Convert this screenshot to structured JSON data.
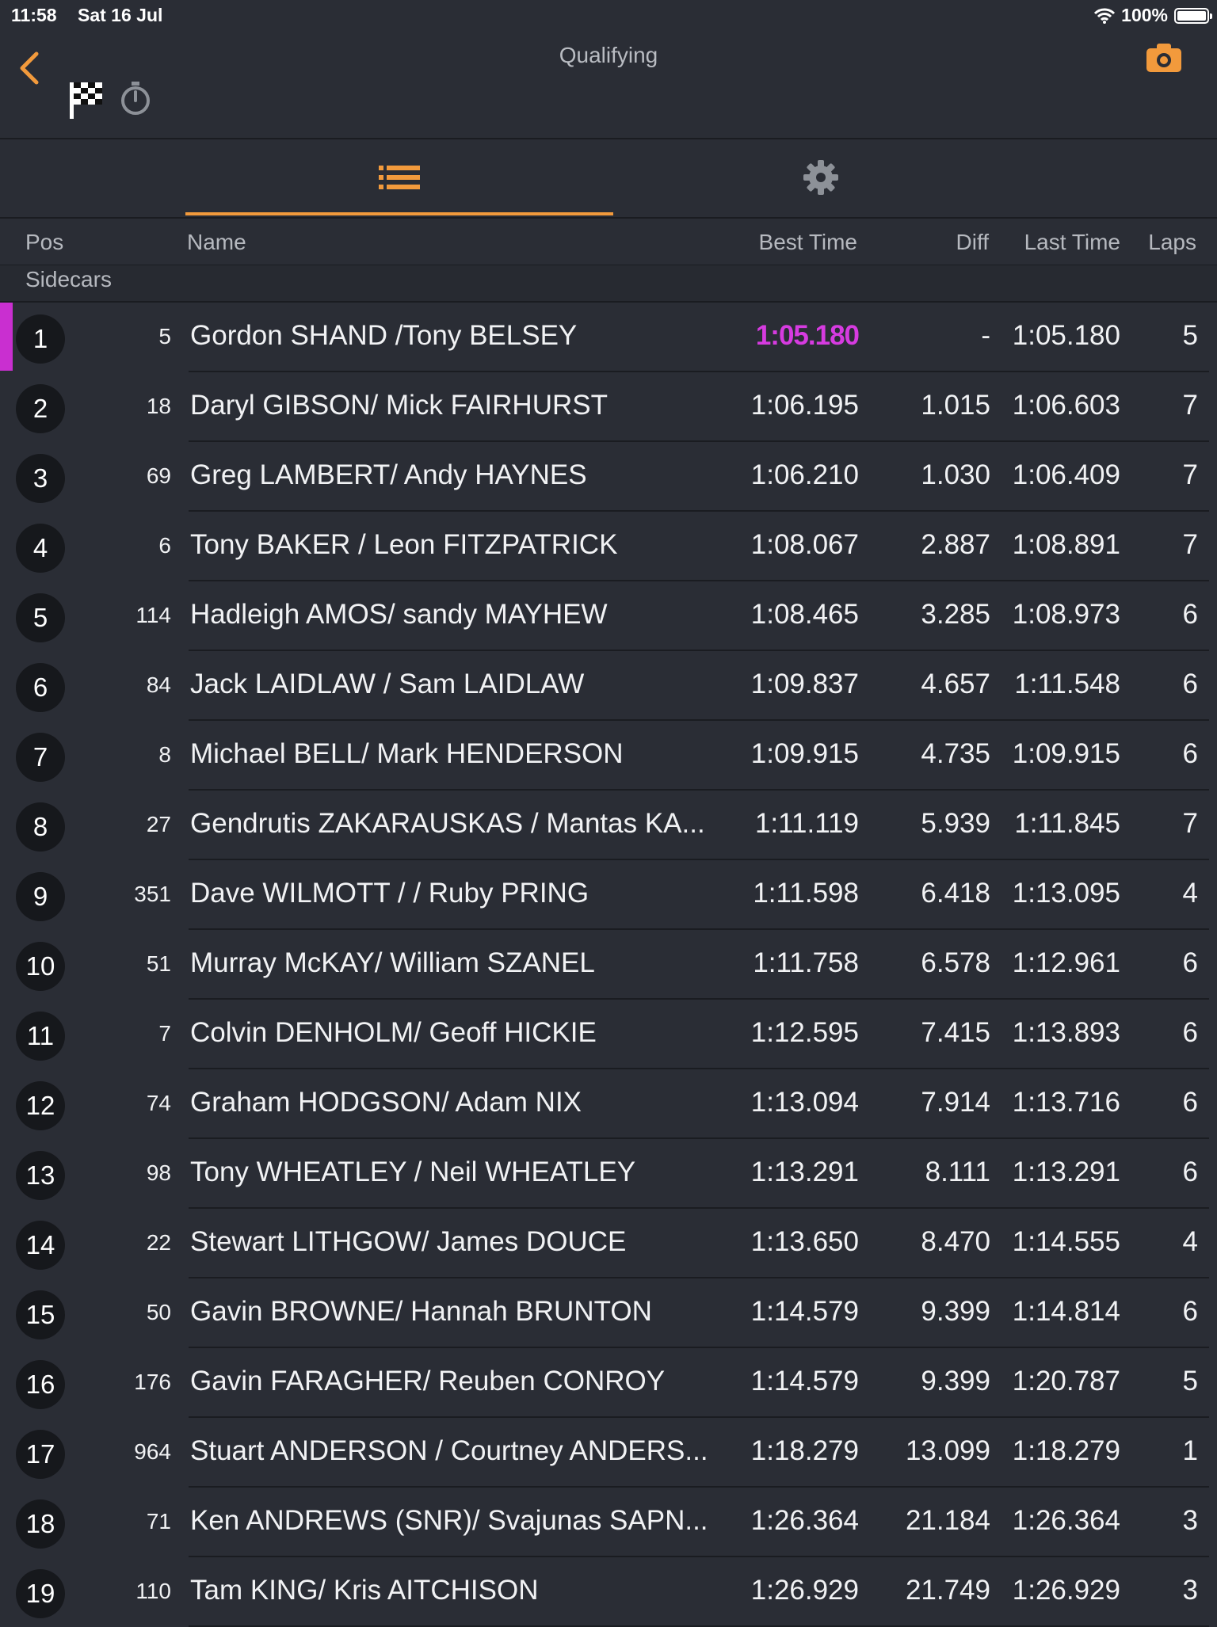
{
  "status_bar": {
    "time": "11:58",
    "date": "Sat 16 Jul",
    "battery": "100%"
  },
  "header": {
    "title": "Qualifying"
  },
  "columns": {
    "pos": "Pos",
    "name": "Name",
    "best": "Best Time",
    "diff": "Diff",
    "last": "Last Time",
    "laps": "Laps"
  },
  "group": "Sidecars",
  "accent_color": "#f29a3c",
  "fastest_color": "#d63be0",
  "rows": [
    {
      "pos": "1",
      "num": "5",
      "name": "Gordon SHAND /Tony BELSEY",
      "best": "1:05.180",
      "diff": "-",
      "last": "1:05.180",
      "laps": "5"
    },
    {
      "pos": "2",
      "num": "18",
      "name": "Daryl GIBSON/ Mick FAIRHURST",
      "best": "1:06.195",
      "diff": "1.015",
      "last": "1:06.603",
      "laps": "7"
    },
    {
      "pos": "3",
      "num": "69",
      "name": "Greg LAMBERT/ Andy HAYNES",
      "best": "1:06.210",
      "diff": "1.030",
      "last": "1:06.409",
      "laps": "7"
    },
    {
      "pos": "4",
      "num": "6",
      "name": "Tony BAKER / Leon FITZPATRICK",
      "best": "1:08.067",
      "diff": "2.887",
      "last": "1:08.891",
      "laps": "7"
    },
    {
      "pos": "5",
      "num": "114",
      "name": "Hadleigh AMOS/ sandy MAYHEW",
      "best": "1:08.465",
      "diff": "3.285",
      "last": "1:08.973",
      "laps": "6"
    },
    {
      "pos": "6",
      "num": "84",
      "name": "Jack LAIDLAW / Sam LAIDLAW",
      "best": "1:09.837",
      "diff": "4.657",
      "last": "1:11.548",
      "laps": "6"
    },
    {
      "pos": "7",
      "num": "8",
      "name": "Michael BELL/ Mark HENDERSON",
      "best": "1:09.915",
      "diff": "4.735",
      "last": "1:09.915",
      "laps": "6"
    },
    {
      "pos": "8",
      "num": "27",
      "name": "Gendrutis ZAKARAUSKAS / Mantas KA...",
      "best": "1:11.119",
      "diff": "5.939",
      "last": "1:11.845",
      "laps": "7"
    },
    {
      "pos": "9",
      "num": "351",
      "name": "Dave WILMOTT / / Ruby PRING",
      "best": "1:11.598",
      "diff": "6.418",
      "last": "1:13.095",
      "laps": "4"
    },
    {
      "pos": "10",
      "num": "51",
      "name": "Murray McKAY/ William SZANEL",
      "best": "1:11.758",
      "diff": "6.578",
      "last": "1:12.961",
      "laps": "6"
    },
    {
      "pos": "11",
      "num": "7",
      "name": "Colvin DENHOLM/ Geoff HICKIE",
      "best": "1:12.595",
      "diff": "7.415",
      "last": "1:13.893",
      "laps": "6"
    },
    {
      "pos": "12",
      "num": "74",
      "name": "Graham HODGSON/ Adam NIX",
      "best": "1:13.094",
      "diff": "7.914",
      "last": "1:13.716",
      "laps": "6"
    },
    {
      "pos": "13",
      "num": "98",
      "name": "Tony WHEATLEY / Neil WHEATLEY",
      "best": "1:13.291",
      "diff": "8.111",
      "last": "1:13.291",
      "laps": "6"
    },
    {
      "pos": "14",
      "num": "22",
      "name": "Stewart LITHGOW/ James DOUCE",
      "best": "1:13.650",
      "diff": "8.470",
      "last": "1:14.555",
      "laps": "4"
    },
    {
      "pos": "15",
      "num": "50",
      "name": "Gavin BROWNE/ Hannah BRUNTON",
      "best": "1:14.579",
      "diff": "9.399",
      "last": "1:14.814",
      "laps": "6"
    },
    {
      "pos": "16",
      "num": "176",
      "name": "Gavin FARAGHER/ Reuben CONROY",
      "best": "1:14.579",
      "diff": "9.399",
      "last": "1:20.787",
      "laps": "5"
    },
    {
      "pos": "17",
      "num": "964",
      "name": "Stuart ANDERSON / Courtney ANDERS...",
      "best": "1:18.279",
      "diff": "13.099",
      "last": "1:18.279",
      "laps": "1"
    },
    {
      "pos": "18",
      "num": "71",
      "name": "Ken ANDREWS (SNR)/ Svajunas SAPN...",
      "best": "1:26.364",
      "diff": "21.184",
      "last": "1:26.364",
      "laps": "3"
    },
    {
      "pos": "19",
      "num": "110",
      "name": "Tam KING/ Kris AITCHISON",
      "best": "1:26.929",
      "diff": "21.749",
      "last": "1:26.929",
      "laps": "3"
    }
  ]
}
